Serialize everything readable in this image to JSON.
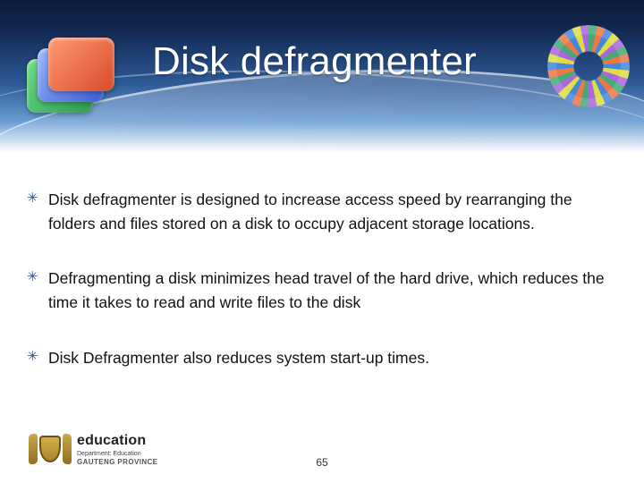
{
  "header": {
    "title": "Disk defragmenter"
  },
  "icons": {
    "defrag": "defrag-blocks-icon",
    "ring": "color-ring-icon"
  },
  "bullets": [
    "Disk defragmenter is designed to increase access speed by rearranging the folders and files stored on a disk to occupy adjacent storage locations.",
    "Defragmenting a disk minimizes head travel of the hard drive, which reduces the time it takes to read and write files to the disk",
    "Disk Defragmenter also reduces system start-up times."
  ],
  "footer": {
    "page_number": "65",
    "logo": {
      "title": "education",
      "subtitle": "Department: Education",
      "province": "GAUTENG PROVINCE"
    }
  }
}
